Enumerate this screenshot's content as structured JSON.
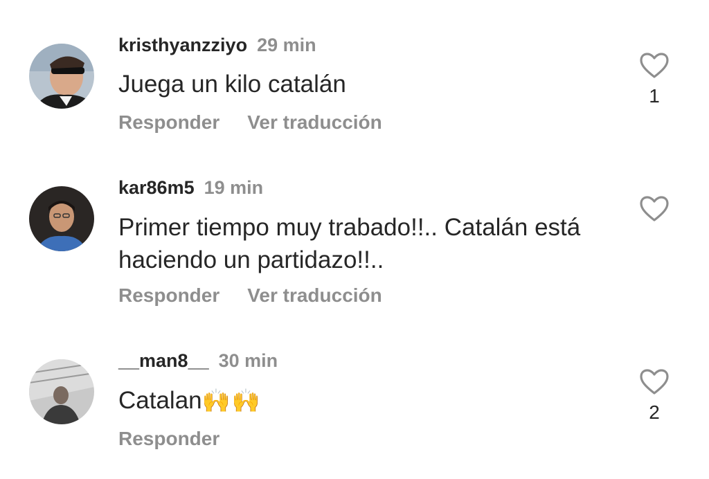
{
  "comments": [
    {
      "username": "kristhyanzziyo",
      "time": "29 min",
      "text": "Juega un kilo catalán",
      "reply_label": "Responder",
      "translate_label": "Ver traducción",
      "likes": "1"
    },
    {
      "username": "kar86m5",
      "time": "19 min",
      "text": "Primer tiempo muy trabado!!.. Catalán está haciendo un partidazo!!..",
      "reply_label": "Responder",
      "translate_label": "Ver traducción",
      "likes": ""
    },
    {
      "username": "__man8__",
      "time": "30 min",
      "text": "Catalan",
      "emoji": "🙌🙌",
      "reply_label": "Responder",
      "likes": "2"
    }
  ],
  "icons": {
    "like": "heart-outline-icon",
    "avatar": "user-avatar"
  },
  "colors": {
    "primary_text": "#262626",
    "secondary_text": "#8e8e8e",
    "background": "#ffffff"
  }
}
